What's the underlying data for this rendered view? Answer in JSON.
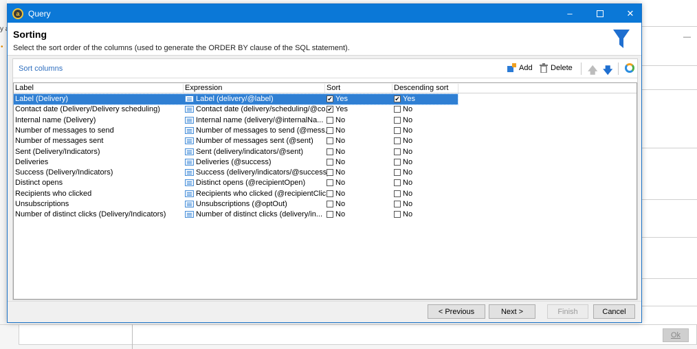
{
  "window": {
    "title": "Query"
  },
  "header": {
    "title": "Sorting",
    "description": "Select the sort order of the columns (used to generate the ORDER BY clause of the SQL statement)."
  },
  "panel": {
    "title": "Sort columns",
    "add_label": "Add",
    "delete_label": "Delete"
  },
  "grid": {
    "headers": [
      "Label",
      "Expression",
      "Sort",
      "Descending sort"
    ],
    "rows": [
      {
        "label": "Label (Delivery)",
        "expression": "Label (delivery/@label)",
        "sort": true,
        "sort_text": "Yes",
        "desc": true,
        "desc_text": "Yes",
        "selected": true
      },
      {
        "label": "Contact date (Delivery/Delivery scheduling)",
        "expression": "Contact date (delivery/scheduling/@co...",
        "sort": true,
        "sort_text": "Yes",
        "desc": false,
        "desc_text": "No"
      },
      {
        "label": "Internal name (Delivery)",
        "expression": "Internal name (delivery/@internalNa...",
        "sort": false,
        "sort_text": "No",
        "desc": false,
        "desc_text": "No"
      },
      {
        "label": "Number of messages to send",
        "expression": "Number of messages to send (@mess...",
        "sort": false,
        "sort_text": "No",
        "desc": false,
        "desc_text": "No"
      },
      {
        "label": "Number of messages sent",
        "expression": "Number of messages sent (@sent)",
        "sort": false,
        "sort_text": "No",
        "desc": false,
        "desc_text": "No"
      },
      {
        "label": "Sent (Delivery/Indicators)",
        "expression": "Sent (delivery/indicators/@sent)",
        "sort": false,
        "sort_text": "No",
        "desc": false,
        "desc_text": "No"
      },
      {
        "label": "Deliveries",
        "expression": "Deliveries (@success)",
        "sort": false,
        "sort_text": "No",
        "desc": false,
        "desc_text": "No"
      },
      {
        "label": "Success (Delivery/Indicators)",
        "expression": "Success (delivery/indicators/@success)",
        "sort": false,
        "sort_text": "No",
        "desc": false,
        "desc_text": "No"
      },
      {
        "label": "Distinct opens",
        "expression": "Distinct opens (@recipientOpen)",
        "sort": false,
        "sort_text": "No",
        "desc": false,
        "desc_text": "No"
      },
      {
        "label": "Recipients who clicked",
        "expression": "Recipients who clicked (@recipientClic...",
        "sort": false,
        "sort_text": "No",
        "desc": false,
        "desc_text": "No"
      },
      {
        "label": "Unsubscriptions",
        "expression": "Unsubscriptions (@optOut)",
        "sort": false,
        "sort_text": "No",
        "desc": false,
        "desc_text": "No"
      },
      {
        "label": "Number of distinct clicks (Delivery/Indicators)",
        "expression": "Number of distinct clicks (delivery/in...",
        "sort": false,
        "sort_text": "No",
        "desc": false,
        "desc_text": "No"
      }
    ]
  },
  "footer": {
    "previous": "< Previous",
    "next": "Next >",
    "finish": "Finish",
    "cancel": "Cancel"
  },
  "background": {
    "ok_label": "Ok",
    "fragment_a": "y a",
    "fragment_dash": "—"
  },
  "colors": {
    "titlebar": "#0b78d7",
    "selection": "#2f7fd3",
    "accent": "#2f6fbf",
    "funnel": "#1f6fd0"
  }
}
